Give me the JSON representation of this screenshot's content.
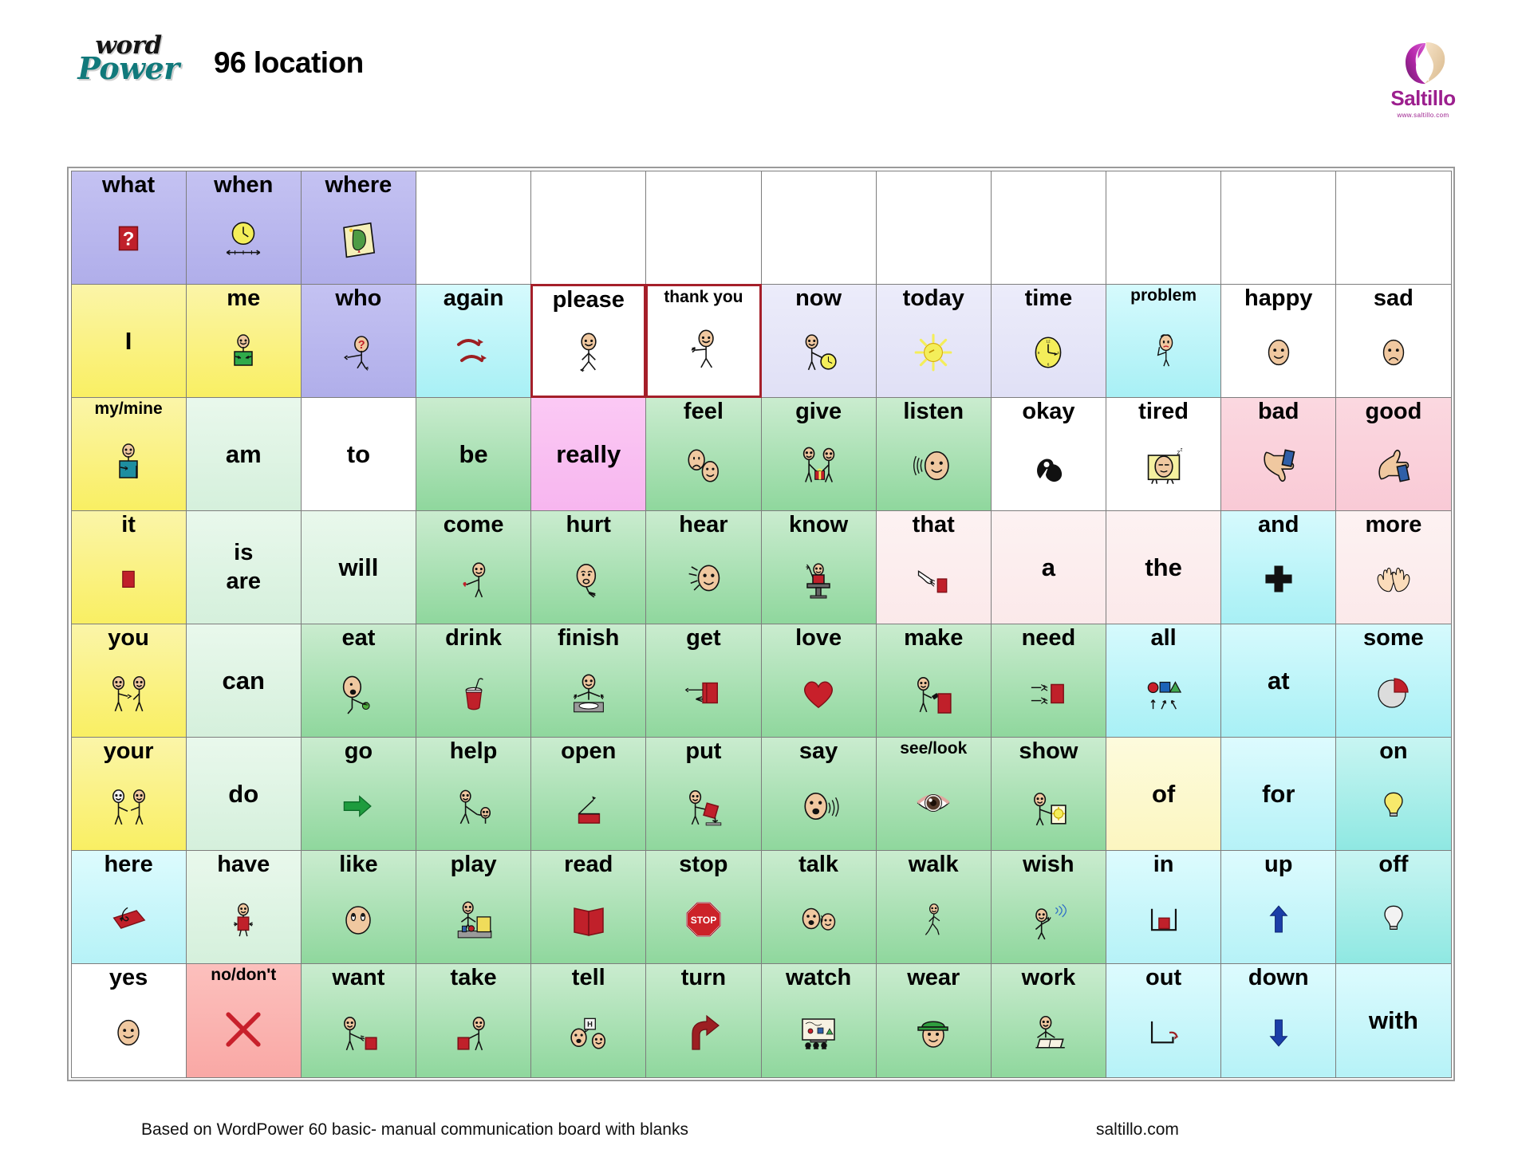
{
  "header": {
    "logo_word": "word",
    "logo_power": "Power",
    "title": "96 location",
    "brand_name": "Saltillo",
    "brand_url": "www.saltillo.com",
    "brand_color": "#9c1f8e",
    "logo_color": "#11797b"
  },
  "footer": {
    "left": "Based on WordPower 60 basic- manual communication board with blanks",
    "right": "saltillo.com"
  },
  "grid": {
    "columns": 12,
    "rows": 8,
    "cells": [
      {
        "label": "what",
        "icon": "question-mark-red-square",
        "bg": "bg-purple"
      },
      {
        "label": "when",
        "icon": "clock-timeline",
        "bg": "bg-purple"
      },
      {
        "label": "where",
        "icon": "map-scroll",
        "bg": "bg-purple"
      },
      {
        "label": "",
        "icon": "",
        "bg": "blank"
      },
      {
        "label": "",
        "icon": "",
        "bg": "blank"
      },
      {
        "label": "",
        "icon": "",
        "bg": "blank"
      },
      {
        "label": "",
        "icon": "",
        "bg": "blank"
      },
      {
        "label": "",
        "icon": "",
        "bg": "blank"
      },
      {
        "label": "",
        "icon": "",
        "bg": "blank"
      },
      {
        "label": "",
        "icon": "",
        "bg": "blank"
      },
      {
        "label": "",
        "icon": "",
        "bg": "blank"
      },
      {
        "label": "",
        "icon": "",
        "bg": "blank"
      },
      {
        "label": "I",
        "icon": "",
        "bg": "bg-yellow",
        "noicon": true
      },
      {
        "label": "me",
        "icon": "person-pointing-self",
        "bg": "bg-yellow"
      },
      {
        "label": "who",
        "icon": "person-question-face",
        "bg": "bg-purple"
      },
      {
        "label": "again",
        "icon": "two-curved-arrows",
        "bg": "bg-cyan"
      },
      {
        "label": "please",
        "icon": "person-standing",
        "bg": "bg-white",
        "border": "red"
      },
      {
        "label": "thank you",
        "icon": "person-waving",
        "bg": "bg-white",
        "border": "red",
        "size": "sm"
      },
      {
        "label": "now",
        "icon": "person-pointing-clock",
        "bg": "bg-lav"
      },
      {
        "label": "today",
        "icon": "sun",
        "bg": "bg-lav"
      },
      {
        "label": "time",
        "icon": "clock",
        "bg": "bg-lav"
      },
      {
        "label": "problem",
        "icon": "person-worried",
        "bg": "bg-cyan",
        "size": "sm"
      },
      {
        "label": "happy",
        "icon": "face-happy",
        "bg": "bg-white"
      },
      {
        "label": "sad",
        "icon": "face-sad",
        "bg": "bg-white"
      },
      {
        "label": "my/mine",
        "icon": "person-hand-chest",
        "bg": "bg-yellow",
        "size": "sm"
      },
      {
        "label": "am",
        "icon": "",
        "bg": "bg-palegrn",
        "noicon": true
      },
      {
        "label": "to",
        "icon": "",
        "bg": "bg-white",
        "noicon": true
      },
      {
        "label": "be",
        "icon": "",
        "bg": "bg-green",
        "noicon": true
      },
      {
        "label": "really",
        "icon": "",
        "bg": "bg-pink",
        "noicon": true
      },
      {
        "label": "feel",
        "icon": "two-faces-emotion",
        "bg": "bg-green"
      },
      {
        "label": "give",
        "icon": "two-people-gift",
        "bg": "bg-green"
      },
      {
        "label": "listen",
        "icon": "face-sound-waves",
        "bg": "bg-green"
      },
      {
        "label": "okay",
        "icon": "ok-hand-black",
        "bg": "bg-white"
      },
      {
        "label": "tired",
        "icon": "person-sleeping-blanket",
        "bg": "bg-white"
      },
      {
        "label": "bad",
        "icon": "thumbs-down",
        "bg": "bg-rose"
      },
      {
        "label": "good",
        "icon": "thumbs-up",
        "bg": "bg-rose"
      },
      {
        "label": "it",
        "icon": "red-box",
        "bg": "bg-yellow"
      },
      {
        "label": "is\nare",
        "icon": "",
        "bg": "bg-palegrn",
        "twoline": true
      },
      {
        "label": "will",
        "icon": "",
        "bg": "bg-palegrn",
        "noicon": true
      },
      {
        "label": "come",
        "icon": "person-beckoning",
        "bg": "bg-green"
      },
      {
        "label": "hurt",
        "icon": "face-pain-hand",
        "bg": "bg-green"
      },
      {
        "label": "hear",
        "icon": "face-hand-ear",
        "bg": "bg-green"
      },
      {
        "label": "know",
        "icon": "person-desk-hand-up",
        "bg": "bg-green"
      },
      {
        "label": "that",
        "icon": "pointing-hand-box",
        "bg": "bg-palepink"
      },
      {
        "label": "a",
        "icon": "",
        "bg": "bg-palepink",
        "noicon": true
      },
      {
        "label": "the",
        "icon": "",
        "bg": "bg-palepink",
        "noicon": true
      },
      {
        "label": "and",
        "icon": "plus-black",
        "bg": "bg-cyan"
      },
      {
        "label": "more",
        "icon": "two-hands",
        "bg": "bg-palepink"
      },
      {
        "label": "you",
        "icon": "two-people-pointing",
        "bg": "bg-yellow"
      },
      {
        "label": "can",
        "icon": "",
        "bg": "bg-palegrn",
        "noicon": true
      },
      {
        "label": "eat",
        "icon": "person-eating",
        "bg": "bg-green"
      },
      {
        "label": "drink",
        "icon": "cup-straw",
        "bg": "bg-green"
      },
      {
        "label": "finish",
        "icon": "person-empty-plate",
        "bg": "bg-green"
      },
      {
        "label": "get",
        "icon": "hand-red-book",
        "bg": "bg-green"
      },
      {
        "label": "love",
        "icon": "red-heart",
        "bg": "bg-green"
      },
      {
        "label": "make",
        "icon": "person-hammer-box",
        "bg": "bg-green"
      },
      {
        "label": "need",
        "icon": "hands-reaching-box",
        "bg": "bg-green"
      },
      {
        "label": "all",
        "icon": "shapes-arrows",
        "bg": "bg-cyan"
      },
      {
        "label": "at",
        "icon": "",
        "bg": "bg-cyan",
        "noicon": true
      },
      {
        "label": "some",
        "icon": "pie-chart-slice",
        "bg": "bg-cyan"
      },
      {
        "label": "your",
        "icon": "two-people-pointing-other",
        "bg": "bg-yellow"
      },
      {
        "label": "do",
        "icon": "",
        "bg": "bg-palegrn",
        "noicon": true
      },
      {
        "label": "go",
        "icon": "green-arrow-right",
        "bg": "bg-green"
      },
      {
        "label": "help",
        "icon": "person-helping-person",
        "bg": "bg-green"
      },
      {
        "label": "open",
        "icon": "box-lid-opening",
        "bg": "bg-green"
      },
      {
        "label": "put",
        "icon": "person-placing-box",
        "bg": "bg-green"
      },
      {
        "label": "say",
        "icon": "face-speaking",
        "bg": "bg-green"
      },
      {
        "label": "see/look",
        "icon": "eye",
        "bg": "bg-green",
        "size": "sm"
      },
      {
        "label": "show",
        "icon": "person-holding-picture",
        "bg": "bg-green"
      },
      {
        "label": "of",
        "icon": "",
        "bg": "bg-cream",
        "noicon": true
      },
      {
        "label": "for",
        "icon": "",
        "bg": "bg-cyan2",
        "noicon": true
      },
      {
        "label": "on",
        "icon": "lightbulb-on",
        "bg": "bg-teal"
      },
      {
        "label": "here",
        "icon": "hand-pointing-surface",
        "bg": "bg-cyan2"
      },
      {
        "label": "have",
        "icon": "person-holding-box",
        "bg": "bg-palegrn"
      },
      {
        "label": "like",
        "icon": "face-eyes-up",
        "bg": "bg-green"
      },
      {
        "label": "play",
        "icon": "person-toys",
        "bg": "bg-green"
      },
      {
        "label": "read",
        "icon": "open-red-book",
        "bg": "bg-green"
      },
      {
        "label": "stop",
        "icon": "stop-sign",
        "bg": "bg-green"
      },
      {
        "label": "talk",
        "icon": "two-faces-talking",
        "bg": "bg-green"
      },
      {
        "label": "walk",
        "icon": "person-walking",
        "bg": "bg-green"
      },
      {
        "label": "wish",
        "icon": "person-thinking-star",
        "bg": "bg-green"
      },
      {
        "label": "in",
        "icon": "box-into-container",
        "bg": "bg-cyan2"
      },
      {
        "label": "up",
        "icon": "blue-arrow-up",
        "bg": "bg-cyan2"
      },
      {
        "label": "off",
        "icon": "lightbulb-off",
        "bg": "bg-teal"
      },
      {
        "label": "yes",
        "icon": "face-yes",
        "bg": "bg-white"
      },
      {
        "label": "no/don't",
        "icon": "red-x",
        "bg": "bg-salmon",
        "size": "sm"
      },
      {
        "label": "want",
        "icon": "person-reaching-box",
        "bg": "bg-green"
      },
      {
        "label": "take",
        "icon": "person-taking-box",
        "bg": "bg-green"
      },
      {
        "label": "tell",
        "icon": "two-faces-speech",
        "bg": "bg-green"
      },
      {
        "label": "turn",
        "icon": "arrow-turn-right",
        "bg": "bg-green"
      },
      {
        "label": "watch",
        "icon": "tv-audience",
        "bg": "bg-green"
      },
      {
        "label": "wear",
        "icon": "face-green-cap",
        "bg": "bg-green"
      },
      {
        "label": "work",
        "icon": "person-at-desk",
        "bg": "bg-green"
      },
      {
        "label": "out",
        "icon": "arrow-out-container",
        "bg": "bg-cyan2"
      },
      {
        "label": "down",
        "icon": "blue-arrow-down",
        "bg": "bg-cyan2"
      },
      {
        "label": "with",
        "icon": "",
        "bg": "bg-cyan2",
        "noicon": true
      }
    ]
  }
}
